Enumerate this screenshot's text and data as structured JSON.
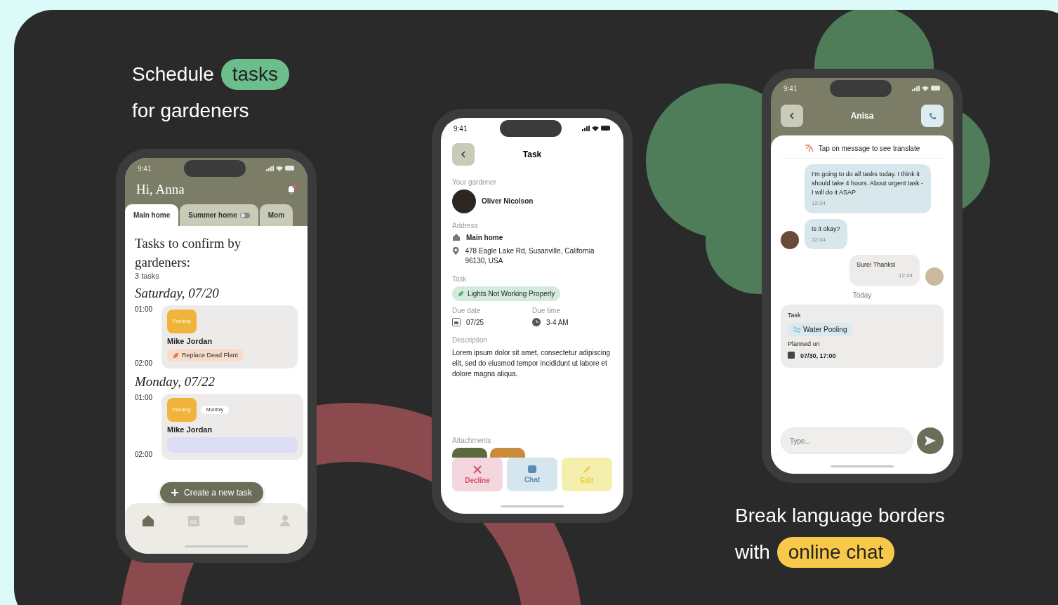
{
  "headline_left": {
    "text": "Schedule",
    "highlight": "tasks",
    "line2": "for gardeners"
  },
  "headline_right": {
    "line1": "Break language borders",
    "text": "with",
    "highlight": "online chat"
  },
  "home_screen": {
    "status_time": "9:41",
    "greeting": "Hi, Anna",
    "tabs": [
      {
        "label": "Main home",
        "selected": true
      },
      {
        "label": "Summer home",
        "selected": false
      },
      {
        "label": "Mom",
        "selected": false
      }
    ],
    "heading": "Tasks to confirm by gardeners:",
    "count": "3 tasks",
    "days": [
      {
        "date": "Saturday, 07/20",
        "start": "01:00",
        "end": "02:00",
        "badges": [
          {
            "label": "Pending",
            "kind": "status"
          }
        ],
        "name": "Mike Jordan",
        "task": {
          "label": "Replace Dead Plant",
          "color": "#f7dccb"
        }
      },
      {
        "date": "Monday, 07/22",
        "start": "01:00",
        "end": "02:00",
        "badges": [
          {
            "label": "Pending",
            "kind": "status"
          },
          {
            "label": "Monthly",
            "kind": "repeat"
          }
        ],
        "name": "Mike Jordan",
        "task": {
          "color": "#dcdcf5"
        }
      }
    ],
    "fab": "Create a new task",
    "nav": [
      {
        "kind": "home",
        "selected": true
      },
      {
        "kind": "calendar",
        "selected": false
      },
      {
        "kind": "chat",
        "selected": false
      },
      {
        "kind": "profile",
        "selected": false
      }
    ]
  },
  "task_screen": {
    "status_time": "9:41",
    "title": "Task",
    "gardener_label": "Your gardener",
    "gardener_name": "Oliver Nicolson",
    "address_label": "Address",
    "home_name": "Main home",
    "address": "478 Eagle Lake Rd, Susanville, California 96130, USA",
    "task_label": "Task",
    "task": "Lights Not Working Properly",
    "due_date_label": "Due date",
    "due_date": "07/25",
    "due_time_label": "Due time",
    "due_time": "3-4 AM",
    "description_label": "Description",
    "description": "Lorem ipsum dolor sit amet, consectetur adipiscing elit, sed do eiusmod tempor incididunt ut labore et dolore magna aliqua.",
    "attachments_label": "Attachments",
    "actions": [
      {
        "label": "Decline",
        "kind": "decline"
      },
      {
        "label": "Chat",
        "kind": "chat"
      },
      {
        "label": "Edit",
        "kind": "edit"
      }
    ]
  },
  "chat_screen": {
    "status_time": "9:41",
    "contact": "Anisa",
    "translate_hint": "Tap on message to see translate",
    "messages": [
      {
        "kind": "incoming",
        "text": "I'm going to do all tasks today. I think it should take 4 hours. About urgent task - I will do it ASAP",
        "time": "12:34"
      },
      {
        "kind": "incoming_avatar",
        "text": "Is it okay?",
        "time": "12:34"
      },
      {
        "kind": "outgoing",
        "text": "Sure! Thanks!",
        "time": "12:34"
      }
    ],
    "date_separator": "Today",
    "task_card": {
      "label": "Task",
      "task": "Water Pooling",
      "planned_label": "Planned on",
      "planned": "07/30, 17:00"
    },
    "input": {
      "placeholder": "Type..."
    }
  }
}
